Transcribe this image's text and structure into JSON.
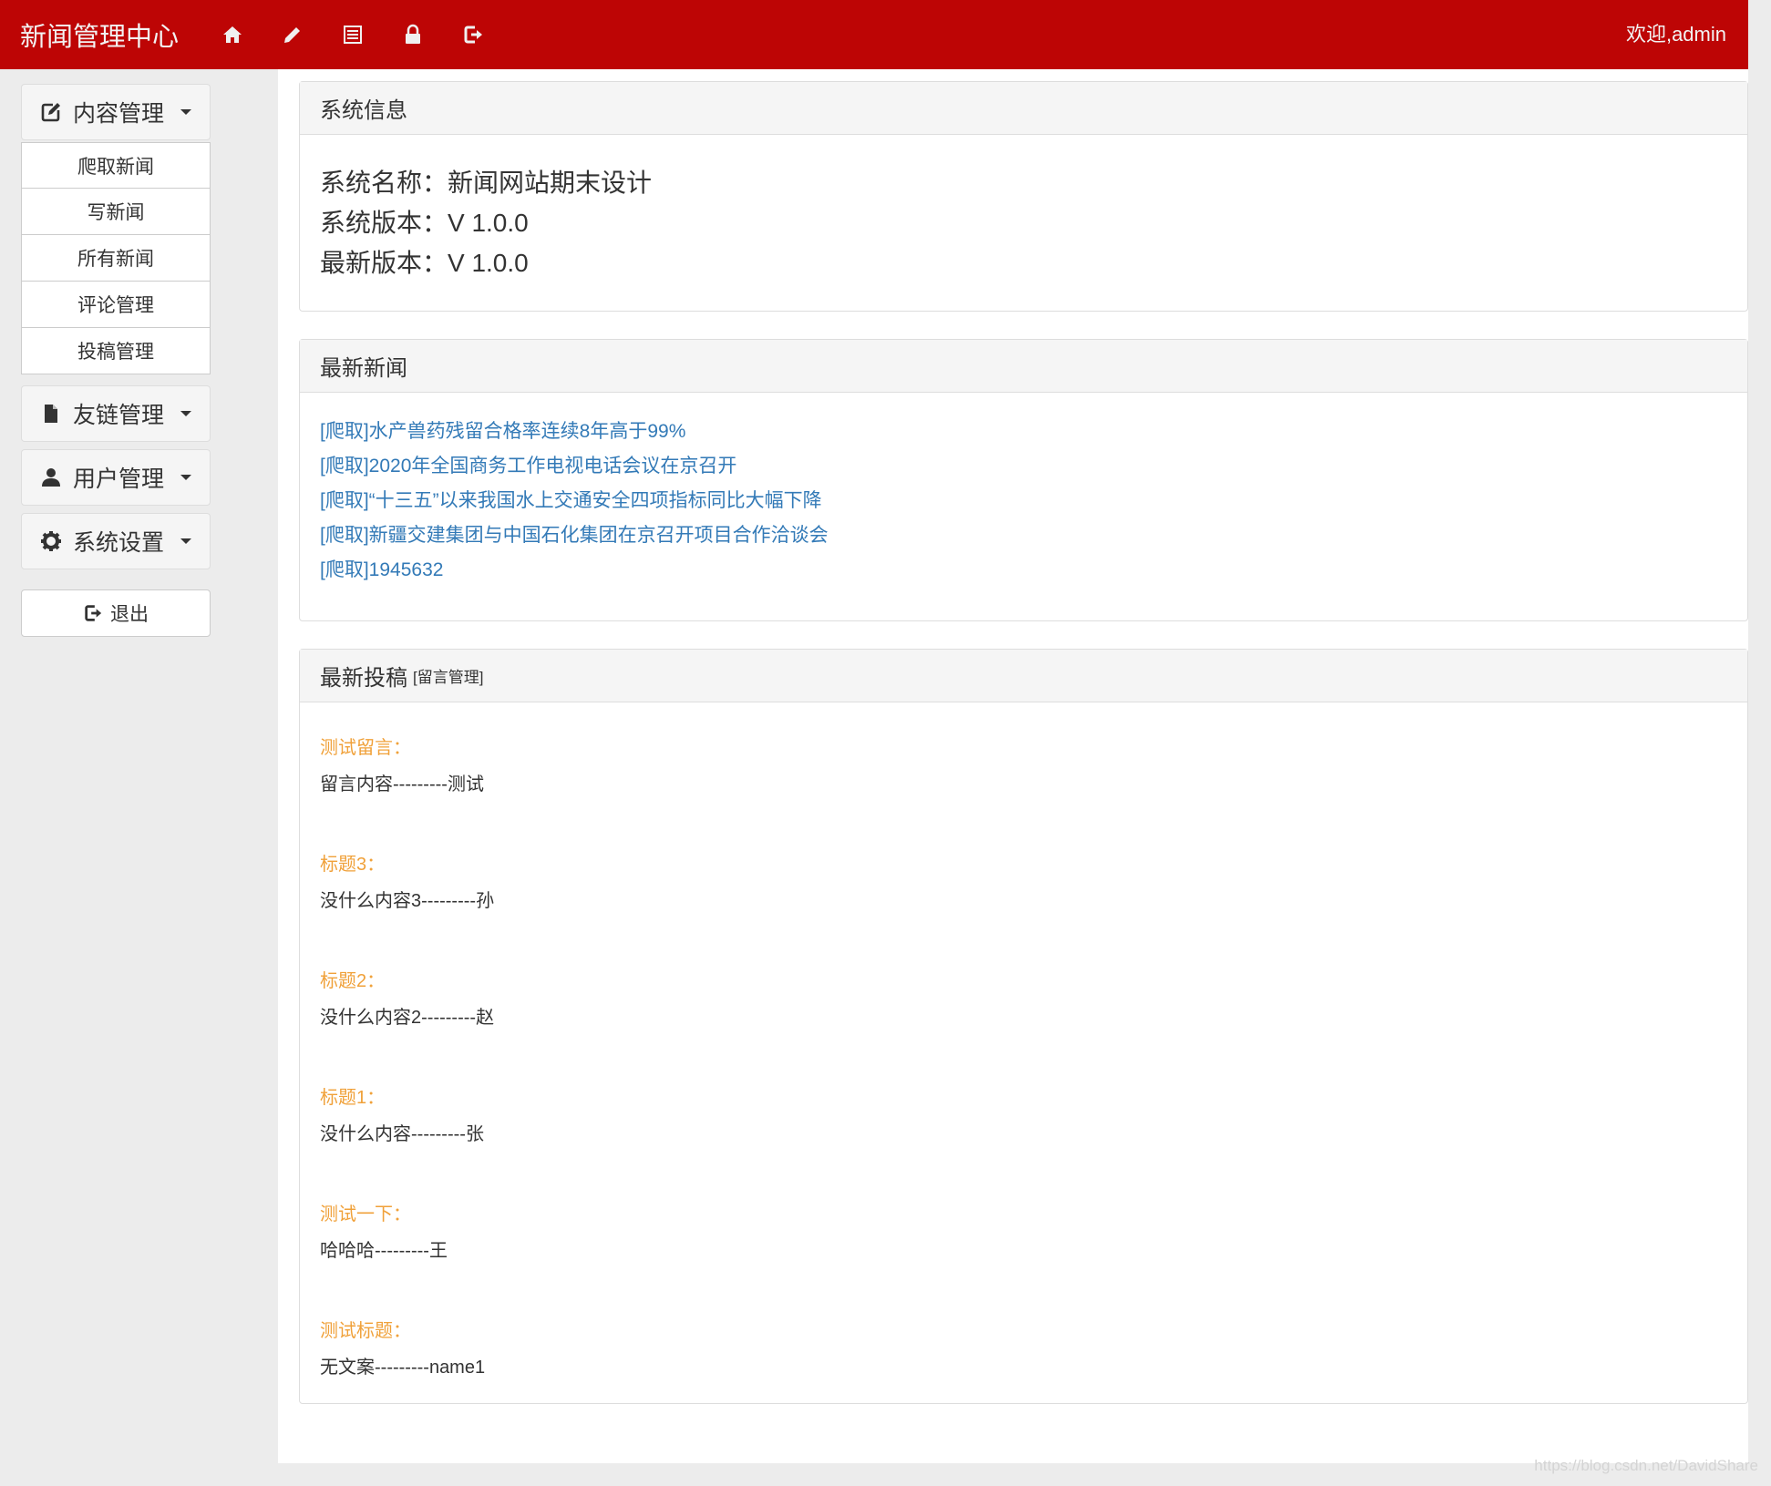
{
  "navbar": {
    "brand": "新闻管理中心",
    "icons": [
      "home-icon",
      "pencil-icon",
      "list-icon",
      "lock-icon",
      "logout-icon"
    ],
    "welcome": "欢迎,admin",
    "bg_color": "#bd0505"
  },
  "sidebar": {
    "groups": [
      {
        "label": "内容管理",
        "icon": "edit-icon"
      },
      {
        "label": "友链管理",
        "icon": "file-icon"
      },
      {
        "label": "用户管理",
        "icon": "user-icon"
      },
      {
        "label": "系统设置",
        "icon": "gear-icon"
      }
    ],
    "content_items": [
      "爬取新闻",
      "写新闻",
      "所有新闻",
      "评论管理",
      "投稿管理"
    ],
    "logout_label": "退出"
  },
  "system_info": {
    "heading": "系统信息",
    "name": "系统名称：新闻网站期末设计",
    "version": "系统版本：V 1.0.0",
    "latest": "最新版本：V 1.0.0"
  },
  "latest_news": {
    "heading": "最新新闻",
    "items": [
      "[爬取]水产兽药残留合格率连续8年高于99%",
      "[爬取]2020年全国商务工作电视电话会议在京召开",
      "[爬取]“十三五”以来我国水上交通安全四项指标同比大幅下降",
      "[爬取]新疆交建集团与中国石化集团在京召开项目合作洽谈会",
      "[爬取]1945632"
    ]
  },
  "latest_submissions": {
    "heading": "最新投稿",
    "heading_link": "[留言管理]",
    "items": [
      {
        "title": "测试留言：",
        "content": "留言内容---------测试"
      },
      {
        "title": "标题3：",
        "content": "没什么内容3---------孙"
      },
      {
        "title": "标题2：",
        "content": "没什么内容2---------赵"
      },
      {
        "title": "标题1：",
        "content": "没什么内容---------张"
      },
      {
        "title": "测试一下：",
        "content": "哈哈哈---------王"
      },
      {
        "title": "测试标题：",
        "content": "无文案---------name1"
      }
    ]
  },
  "watermark": "https://blog.csdn.net/DavidShare"
}
